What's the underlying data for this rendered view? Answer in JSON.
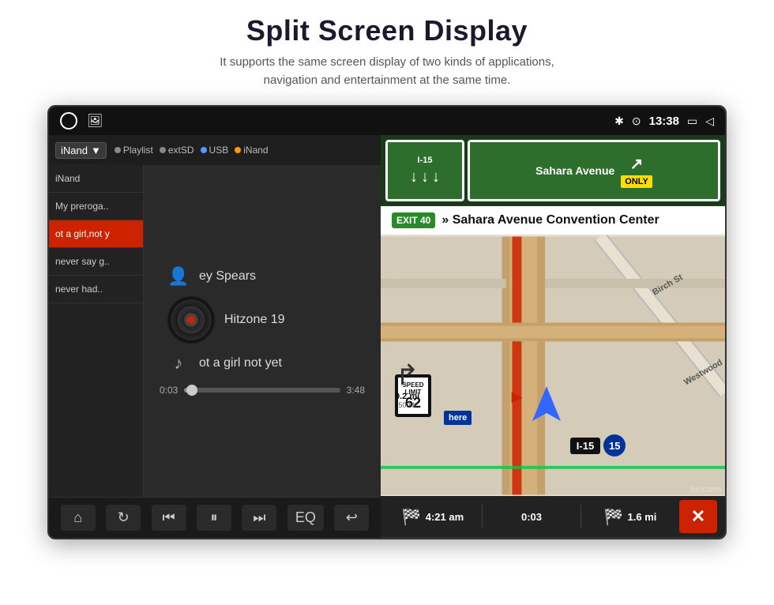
{
  "header": {
    "title": "Split Screen Display",
    "subtitle": "It supports the same screen display of two kinds of applications,\nnavigation and entertainment at the same time."
  },
  "status_bar": {
    "time": "13:38",
    "bluetooth": "✱",
    "location": "⊙"
  },
  "music": {
    "source_label": "iNand",
    "source_dropdown_arrow": "▼",
    "sources": [
      "Playlist",
      "extSD",
      "USB",
      "iNand"
    ],
    "playlist": [
      {
        "title": "iNand",
        "active": false
      },
      {
        "title": "My preroga..",
        "active": false
      },
      {
        "title": "ot a girl,not y",
        "active": true
      },
      {
        "title": "never say g..",
        "active": false
      },
      {
        "title": "never had..",
        "active": false
      }
    ],
    "now_playing": {
      "artist": "ey Spears",
      "album": "Hitzone 19",
      "track": "ot a girl not yet"
    },
    "progress": {
      "current": "0:03",
      "total": "3:48",
      "percent": 5
    },
    "controls": {
      "home": "⌂",
      "repeat": "↻",
      "prev": "⏮",
      "pause": "⏸",
      "next": "⏭",
      "eq": "EQ",
      "back": "↩"
    }
  },
  "navigation": {
    "exit_number": "EXIT 40",
    "exit_text": "» Sahara Avenue Convention Center",
    "highway": "I-15",
    "highway_number": "15",
    "speed_limit_label": "LIMIT",
    "speed_limit": "62",
    "distance_turn": "0.2 mi",
    "highway_arrow_label": "I-15",
    "signs": {
      "top_arrows": "↓  ↓  ↓",
      "only": "ONLY"
    },
    "bottom": {
      "time1": "4:21 am",
      "time2": "0:03",
      "distance": "1.6 mi"
    }
  },
  "watermark": "Seicane"
}
